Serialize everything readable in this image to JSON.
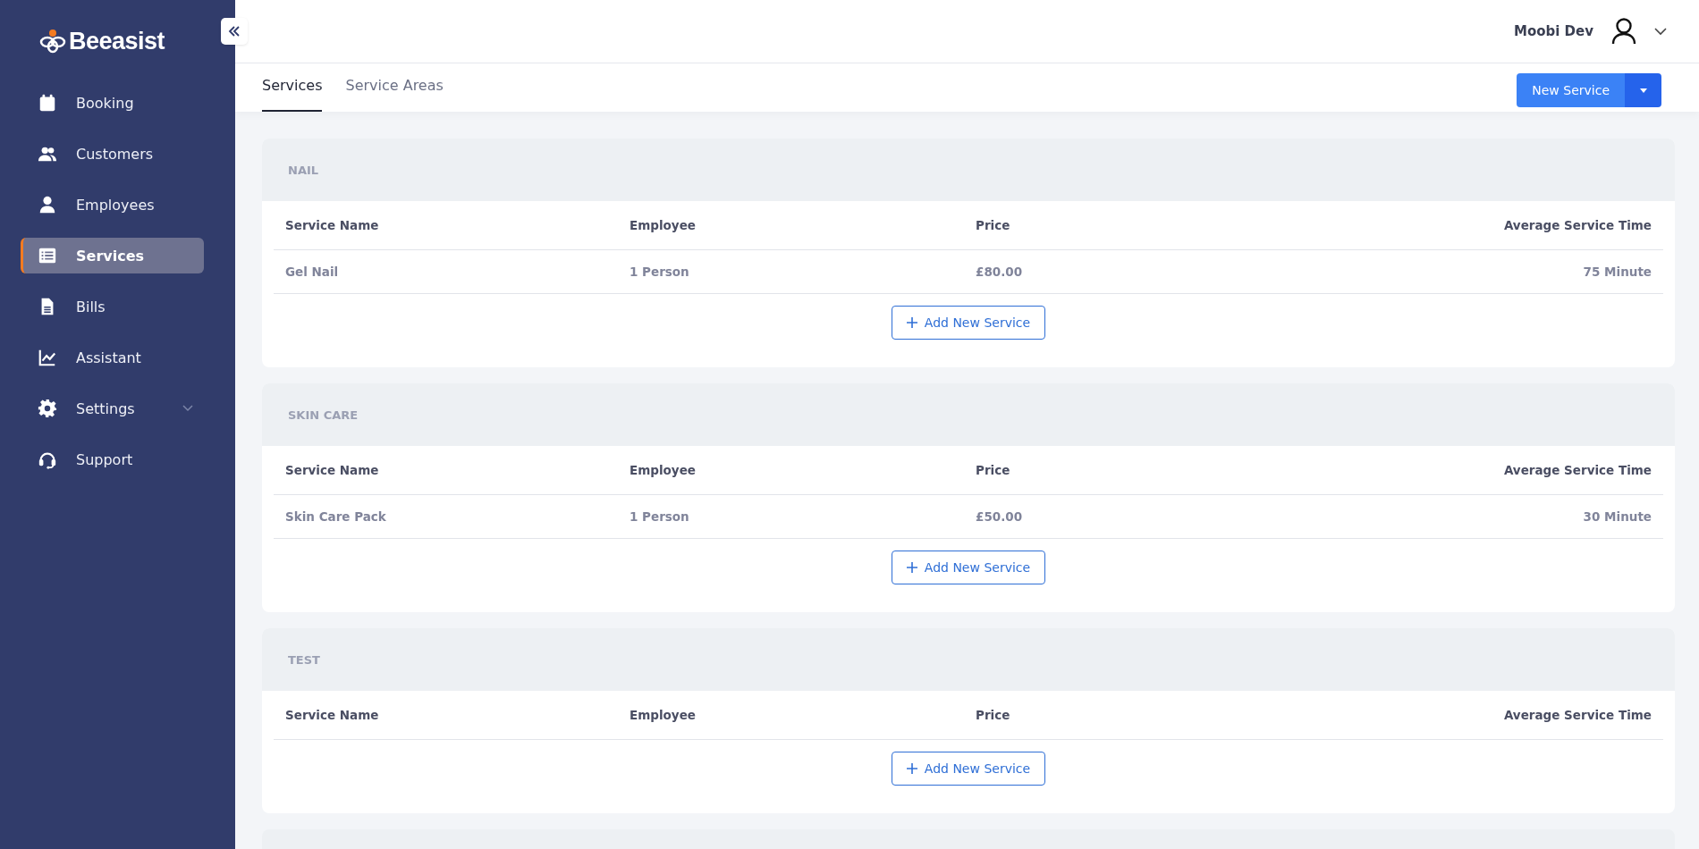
{
  "sidebar": {
    "logo": "Beeasist",
    "items": [
      {
        "label": "Booking",
        "kind": "calendar",
        "selected": false,
        "has_submenu": false
      },
      {
        "label": "Customers",
        "kind": "users",
        "selected": false,
        "has_submenu": false
      },
      {
        "label": "Employees",
        "kind": "user",
        "selected": false,
        "has_submenu": false
      },
      {
        "label": "Services",
        "kind": "list",
        "selected": true,
        "has_submenu": false
      },
      {
        "label": "Bills",
        "kind": "file",
        "selected": false,
        "has_submenu": false
      },
      {
        "label": "Assistant",
        "kind": "chart",
        "selected": false,
        "has_submenu": false
      },
      {
        "label": "Settings",
        "kind": "gear",
        "selected": false,
        "has_submenu": true
      },
      {
        "label": "Support",
        "kind": "headset",
        "selected": false,
        "has_submenu": false
      }
    ]
  },
  "header": {
    "user_name": "Moobi Dev"
  },
  "tabs": [
    {
      "label": "Services",
      "selected": true
    },
    {
      "label": "Service Areas",
      "selected": false
    }
  ],
  "new_service_button": "New Service",
  "categories": [
    {
      "name": "NAIL",
      "columns": [
        "Service Name",
        "Employee",
        "Price",
        "Average Service Time"
      ],
      "rows": [
        [
          "Gel Nail",
          "1 Person",
          "£80.00",
          "75 Minute"
        ]
      ],
      "add_button": "Add New Service"
    },
    {
      "name": "SKIN CARE",
      "columns": [
        "Service Name",
        "Employee",
        "Price",
        "Average Service Time"
      ],
      "rows": [
        [
          "Skin Care Pack",
          "1 Person",
          "£50.00",
          "30 Minute"
        ]
      ],
      "add_button": "Add New Service"
    },
    {
      "name": "TEST",
      "columns": [
        "Service Name",
        "Employee",
        "Price",
        "Average Service Time"
      ],
      "add_button": "Add New Service"
    }
  ]
}
